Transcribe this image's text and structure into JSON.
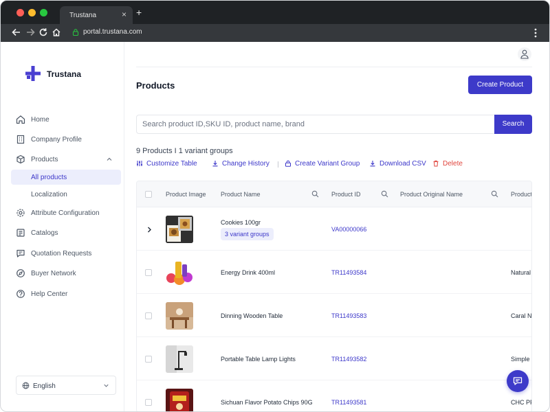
{
  "browser": {
    "tab_title": "Trustana",
    "tab_close": "×",
    "new_tab": "+",
    "url": "portal.trustana.com"
  },
  "sidebar": {
    "brand": "Trustana",
    "items": [
      {
        "label": "Home",
        "icon": "home-icon"
      },
      {
        "label": "Company Profile",
        "icon": "building-icon"
      },
      {
        "label": "Products",
        "icon": "box-icon"
      },
      {
        "label": "All products"
      },
      {
        "label": "Localization"
      },
      {
        "label": "Attribute Configuration",
        "icon": "gear-icon"
      },
      {
        "label": "Catalogs",
        "icon": "catalog-icon"
      },
      {
        "label": "Quotation Requests",
        "icon": "message-icon"
      },
      {
        "label": "Buyer Network",
        "icon": "compass-icon"
      },
      {
        "label": "Help Center",
        "icon": "help-icon"
      }
    ],
    "language": "English"
  },
  "header": {
    "title": "Products",
    "create_button": "Create Product"
  },
  "search": {
    "placeholder": "Search product ID,SKU ID, product name, brand",
    "button": "Search"
  },
  "summary": "9 Products I 1 variant groups",
  "actions": [
    {
      "label": "Customize Table",
      "icon": "sliders-icon"
    },
    {
      "label": "Change History",
      "icon": "download-icon"
    },
    {
      "label": "Create Variant Group",
      "icon": "lock-icon"
    },
    {
      "label": "Download CSV",
      "icon": "download-icon"
    },
    {
      "label": "Delete",
      "icon": "trash-icon"
    }
  ],
  "table": {
    "columns": [
      "Product Image",
      "Product Name",
      "Product ID",
      "Product Original Name",
      "Product"
    ],
    "rows": [
      {
        "name": "Cookies 100gr",
        "badge": "3 variant groups",
        "id": "VA00000066",
        "original": ""
      },
      {
        "name": "Energy Drink 400ml",
        "id": "TR11493584",
        "original": "Natural"
      },
      {
        "name": "Dinning Wooden Table",
        "id": "TR11493583",
        "original": "Caral Na"
      },
      {
        "name": "Portable Table Lamp Lights",
        "id": "TR11493582",
        "original": "Simple E"
      },
      {
        "name": "Sichuan Flavor Potato Chips 90G",
        "id": "TR11493581",
        "original": "CHC PP"
      }
    ]
  },
  "colors": {
    "primary": "#3d3ac9",
    "danger": "#e0443c",
    "active_bg": "#eceefc"
  }
}
